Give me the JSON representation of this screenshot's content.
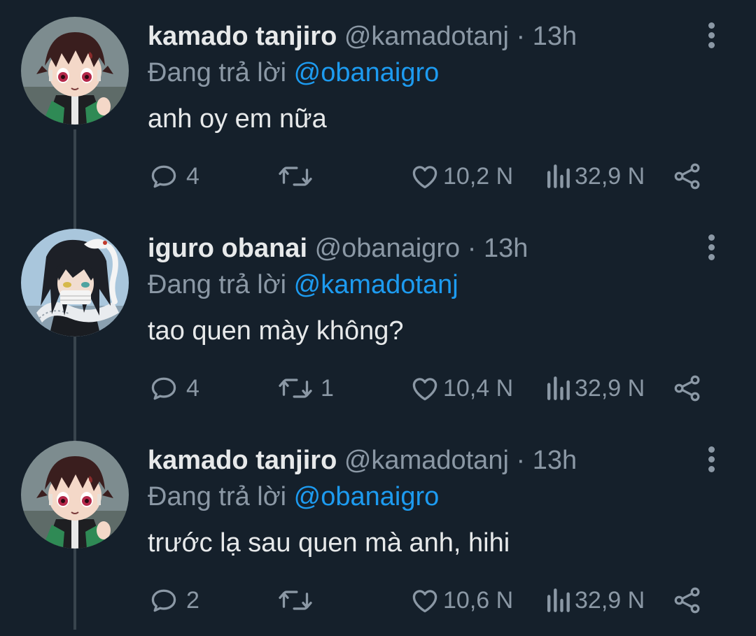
{
  "tweets": [
    {
      "author": {
        "name": "kamado tanjiro",
        "handle": "@kamadotanj",
        "avatar": "tanjiro-avatar"
      },
      "separator": "·",
      "time": "13h",
      "reply_prefix": "Đang trả lời",
      "reply_to": "@obanaigro",
      "text": "anh oy em nữa",
      "actions": {
        "replies": "4",
        "retweets": "",
        "likes": "10,2 N",
        "views": "32,9 N"
      }
    },
    {
      "author": {
        "name": "iguro obanai",
        "handle": "@obanaigro",
        "avatar": "obanai-avatar"
      },
      "separator": "·",
      "time": "13h",
      "reply_prefix": "Đang trả lời",
      "reply_to": "@kamadotanj",
      "text": "tao quen mày không?",
      "actions": {
        "replies": "4",
        "retweets": "1",
        "likes": "10,4 N",
        "views": "32,9 N"
      }
    },
    {
      "author": {
        "name": "kamado tanjiro",
        "handle": "@kamadotanj",
        "avatar": "tanjiro-avatar"
      },
      "separator": "·",
      "time": "13h",
      "reply_prefix": "Đang trả lời",
      "reply_to": "@obanaigro",
      "text": "trước lạ sau quen mà anh, hihi",
      "actions": {
        "replies": "2",
        "retweets": "",
        "likes": "10,6 N",
        "views": "32,9 N"
      }
    }
  ],
  "colors": {
    "background": "#15202b",
    "primary_text": "#e7e9ea",
    "secondary_text": "#8b98a5",
    "accent": "#1d9bf0",
    "thread_line": "#38444d"
  },
  "icons": [
    "reply-icon",
    "retweet-icon",
    "like-icon",
    "views-icon",
    "share-icon",
    "more-options-icon"
  ]
}
